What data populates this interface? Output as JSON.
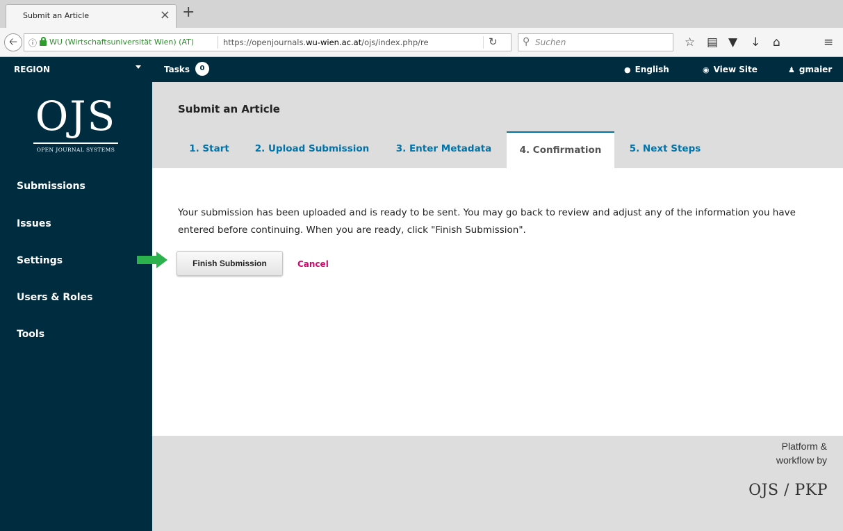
{
  "browser": {
    "tab_title": "Submit an Article",
    "tab_close": "×",
    "new_tab": "+",
    "site_identity": "WU (Wirtschaftsuniversität Wien) (AT)",
    "url_prefix": "https://openjournals.",
    "url_domain": "wu-wien.ac.at",
    "url_suffix": "/ojs/index.php/re",
    "search_placeholder": "Suchen"
  },
  "topbar": {
    "context": "REGION",
    "tasks_label": "Tasks",
    "tasks_count": "0",
    "language": "English",
    "view_site": "View Site",
    "user": "gmaier"
  },
  "logo": {
    "main": "OJS",
    "sub": "OPEN JOURNAL SYSTEMS"
  },
  "sidebar": {
    "items": [
      {
        "label": "Submissions"
      },
      {
        "label": "Issues"
      },
      {
        "label": "Settings"
      },
      {
        "label": "Users & Roles"
      },
      {
        "label": "Tools"
      }
    ]
  },
  "page": {
    "title": "Submit an Article",
    "tabs": [
      {
        "label": "1. Start"
      },
      {
        "label": "2. Upload Submission"
      },
      {
        "label": "3. Enter Metadata"
      },
      {
        "label": "4. Confirmation",
        "active": true
      },
      {
        "label": "5. Next Steps"
      }
    ],
    "message": "Your submission has been uploaded and is ready to be sent. You may go back to review and adjust any of the information you have entered before continuing. When you are ready, click \"Finish Submission\".",
    "finish_button": "Finish Submission",
    "cancel_link": "Cancel"
  },
  "footer": {
    "line1": "Platform &",
    "line2": "workflow by",
    "brand": "OJS / PKP"
  },
  "colors": {
    "app_dark": "#002c40",
    "link_blue": "#0073a8",
    "cancel_pink": "#d00a6c",
    "arrow_green": "#2bb24c",
    "band_gray": "#dddddd"
  },
  "icons": [
    "back-arrow-icon",
    "info-icon",
    "lock-icon",
    "reload-icon",
    "search-icon",
    "star-icon",
    "reading-list-icon",
    "pocket-icon",
    "download-icon",
    "home-icon",
    "menu-icon",
    "globe-icon",
    "eye-icon",
    "user-icon",
    "caret-down-icon"
  ]
}
